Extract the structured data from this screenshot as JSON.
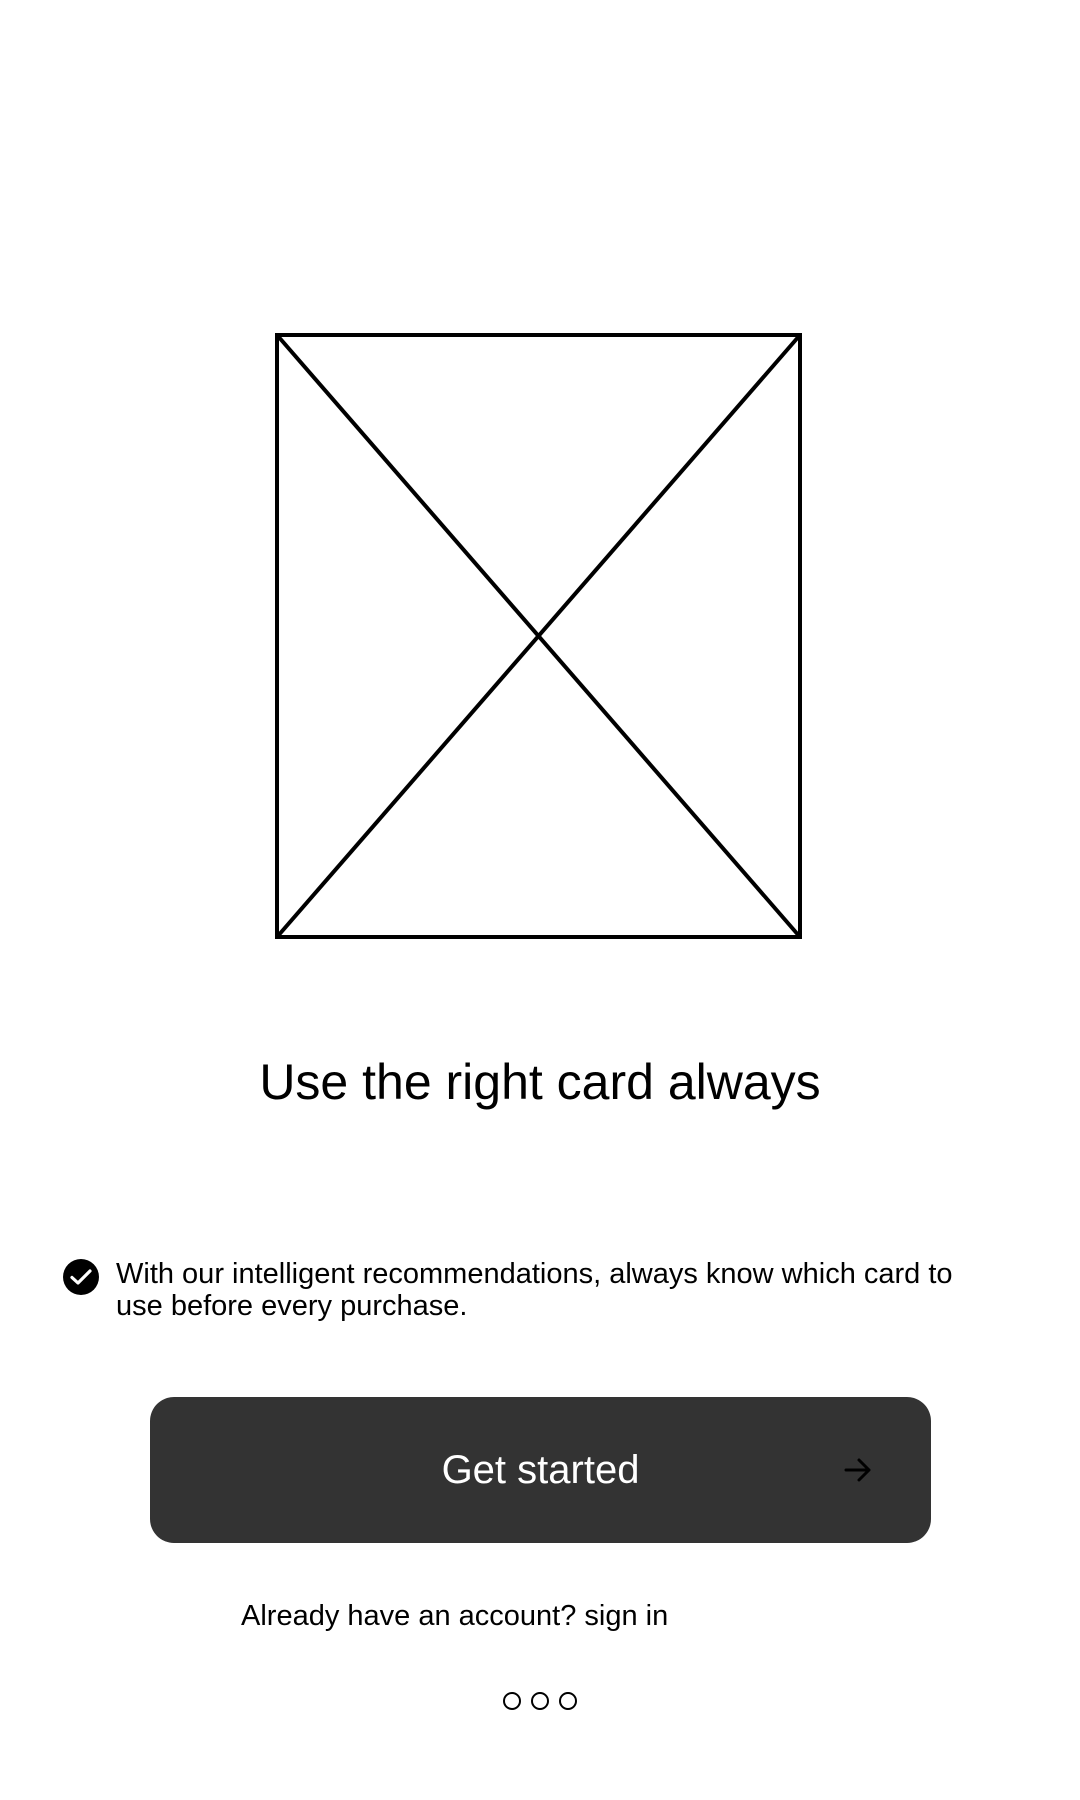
{
  "onboarding": {
    "hero_image_icon": "image-placeholder-icon",
    "headline": "Use the right card always",
    "feature": {
      "icon": "check-badge-icon",
      "text": "With our intelligent recommendations, always know which card to use before every purchase."
    },
    "cta": {
      "label": "Get started",
      "icon": "arrow-right-icon"
    },
    "signin_text": "Already have an account? sign in",
    "pager": {
      "page_count": 3
    }
  },
  "colors": {
    "background": "#ffffff",
    "button": "#333333",
    "button_text": "#ffffff",
    "text": "#000000"
  }
}
